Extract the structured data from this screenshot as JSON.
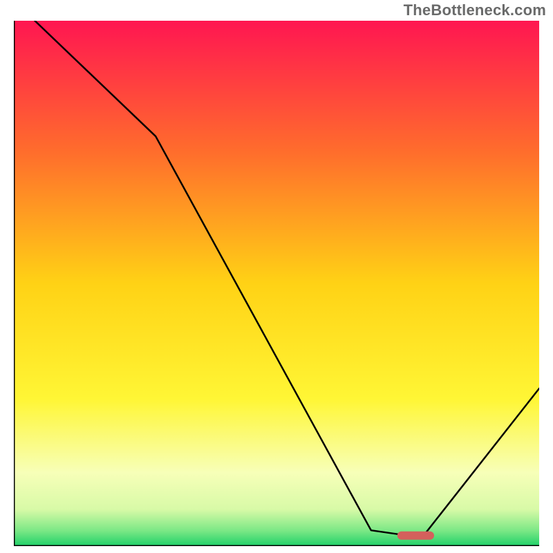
{
  "watermark": "TheBottleneck.com",
  "chart_data": {
    "type": "line",
    "title": "",
    "xlabel": "",
    "ylabel": "",
    "xlim": [
      0,
      100
    ],
    "ylim": [
      0,
      100
    ],
    "x": [
      4,
      27,
      68,
      75,
      78,
      100
    ],
    "values": [
      100,
      78,
      3,
      2,
      2,
      30
    ],
    "marker": {
      "x_range": [
        73,
        80
      ],
      "y": 2,
      "color": "#d4605c"
    },
    "gradient_stops": [
      {
        "offset": 0.0,
        "color": "#ff1651"
      },
      {
        "offset": 0.25,
        "color": "#ff6d2c"
      },
      {
        "offset": 0.5,
        "color": "#ffd215"
      },
      {
        "offset": 0.72,
        "color": "#fff635"
      },
      {
        "offset": 0.86,
        "color": "#f7ffb8"
      },
      {
        "offset": 0.93,
        "color": "#d8faa7"
      },
      {
        "offset": 0.97,
        "color": "#7de886"
      },
      {
        "offset": 1.0,
        "color": "#1fd169"
      }
    ]
  }
}
